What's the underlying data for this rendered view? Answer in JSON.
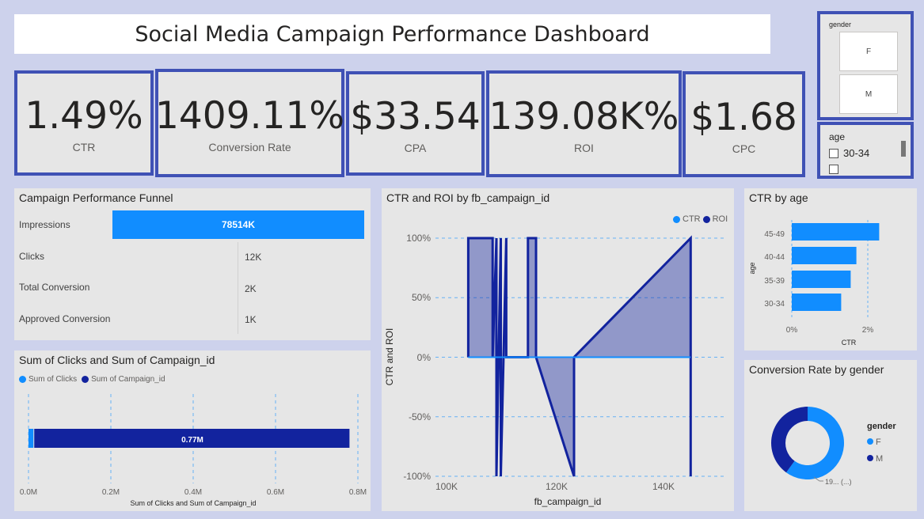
{
  "dashboard": {
    "title": "Social Media Campaign Performance Dashboard"
  },
  "kpis": [
    {
      "value": "1.49%",
      "label": "CTR"
    },
    {
      "value": "1409.11%",
      "label": "Conversion Rate"
    },
    {
      "value": "$33.54",
      "label": "CPA"
    },
    {
      "value": "139.08K%",
      "label": "ROI"
    },
    {
      "value": "$1.68",
      "label": "CPC"
    }
  ],
  "slicers": {
    "gender": {
      "header": "gender",
      "options": [
        "F",
        "M"
      ]
    },
    "age": {
      "header": "age",
      "visible_option": "30-34"
    }
  },
  "funnel": {
    "title": "Campaign Performance Funnel",
    "rows": [
      {
        "label": "Impressions",
        "value": "78514K"
      },
      {
        "label": "Clicks",
        "value": "12K"
      },
      {
        "label": "Total Conversion",
        "value": "2K"
      },
      {
        "label": "Approved Conversion",
        "value": "1K"
      }
    ]
  },
  "clicks_chart": {
    "title": "Sum of Clicks and Sum of Campaign_id",
    "legend": [
      "Sum of Clicks",
      "Sum of Campaign_id"
    ],
    "data_label": "0.77M",
    "x_ticks": [
      "0.0M",
      "0.2M",
      "0.4M",
      "0.6M",
      "0.8M"
    ],
    "xlabel": "Sum of Clicks and Sum of Campaign_id"
  },
  "line_chart": {
    "title": "CTR and ROI by fb_campaign_id",
    "legend": [
      "CTR",
      "ROI"
    ],
    "y_ticks": [
      "100%",
      "50%",
      "0%",
      "-50%",
      "-100%"
    ],
    "x_ticks": [
      "100K",
      "120K",
      "140K"
    ],
    "xlabel": "fb_campaign_id",
    "ylabel": "CTR and ROI"
  },
  "age_chart": {
    "title": "CTR by age",
    "categories": [
      "45-49",
      "40-44",
      "35-39",
      "30-34"
    ],
    "x_ticks": [
      "0%",
      "2%"
    ],
    "xlabel": "CTR",
    "ylabel": "age"
  },
  "donut_chart": {
    "title": "Conversion Rate by gender",
    "legend_title": "gender",
    "legend": [
      "F",
      "M"
    ],
    "slice_label": "19... (...)"
  },
  "colors": {
    "accent_light": "#118dff",
    "accent_dark": "#12239e",
    "border": "#3f51b5",
    "background": "#cdd2ec"
  },
  "chart_data": [
    {
      "type": "bar",
      "title": "Campaign Performance Funnel",
      "categories": [
        "Impressions",
        "Clicks",
        "Total Conversion",
        "Approved Conversion"
      ],
      "values": [
        78514000,
        12000,
        2000,
        1000
      ]
    },
    {
      "type": "bar",
      "title": "Sum of Clicks and Sum of Campaign_id",
      "xlabel": "Sum of Clicks and Sum of Campaign_id",
      "xlim": [
        0,
        0.8
      ],
      "series": [
        {
          "name": "Sum of Clicks",
          "values": [
            0.012
          ]
        },
        {
          "name": "Sum of Campaign_id",
          "values": [
            0.77
          ]
        }
      ]
    },
    {
      "type": "area",
      "title": "CTR and ROI by fb_campaign_id",
      "xlabel": "fb_campaign_id",
      "ylabel": "CTR and ROI",
      "xlim": [
        95000,
        150000
      ],
      "ylim": [
        -100,
        100
      ],
      "series": [
        {
          "name": "CTR",
          "x": [
            104000,
            145000
          ],
          "y": [
            0,
            0
          ]
        },
        {
          "name": "ROI",
          "x": [
            104000,
            104000,
            108500,
            108500,
            109200,
            109200,
            110000,
            110000,
            111000,
            111000,
            112000,
            112000,
            115000,
            115000,
            116500,
            116500,
            123500,
            123500,
            145000,
            145000
          ],
          "y": [
            0,
            100,
            100,
            0,
            100,
            -100,
            100,
            -100,
            100,
            0,
            0,
            0,
            0,
            100,
            100,
            0,
            -100,
            0,
            100,
            -100
          ]
        }
      ]
    },
    {
      "type": "bar",
      "title": "CTR by age",
      "xlabel": "CTR",
      "ylabel": "age",
      "xlim": [
        0,
        2.5
      ],
      "categories": [
        "45-49",
        "40-44",
        "35-39",
        "30-34"
      ],
      "values": [
        2.3,
        1.7,
        1.55,
        1.3
      ]
    },
    {
      "type": "pie",
      "title": "Conversion Rate by gender",
      "categories": [
        "F",
        "M"
      ],
      "values": [
        60,
        40
      ]
    }
  ]
}
